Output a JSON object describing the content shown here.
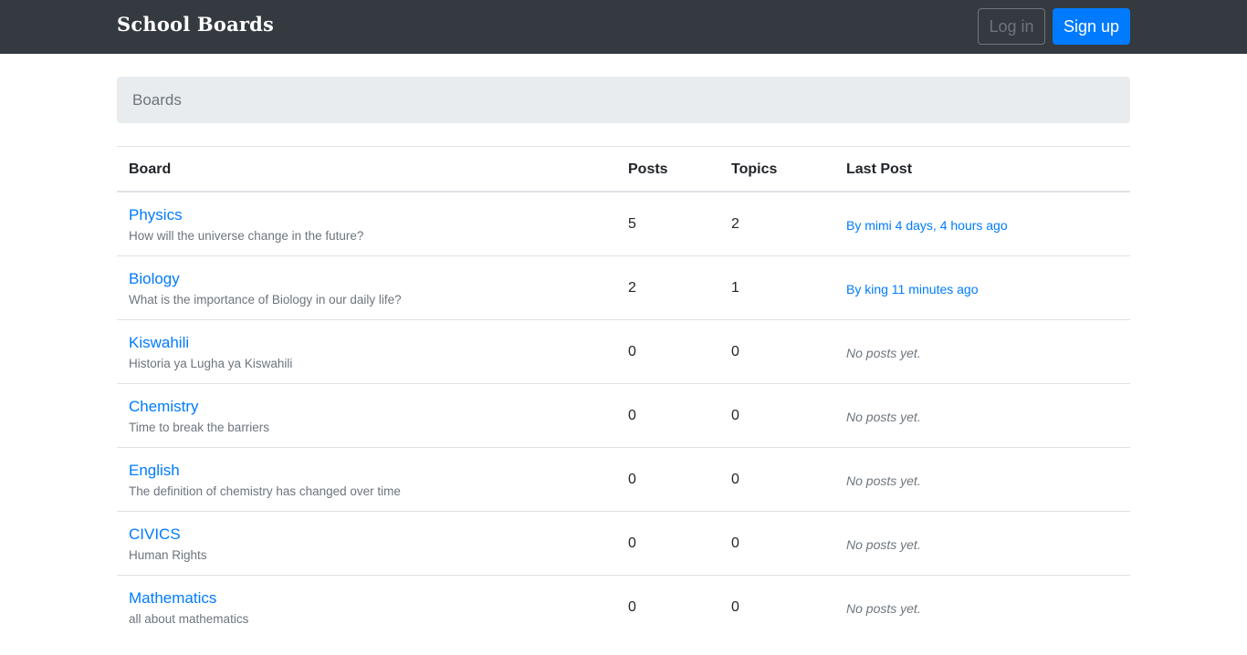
{
  "navbar": {
    "brand": "School Boards",
    "login_label": "Log in",
    "signup_label": "Sign up"
  },
  "breadcrumb": {
    "current": "Boards"
  },
  "table": {
    "headers": {
      "board": "Board",
      "posts": "Posts",
      "topics": "Topics",
      "last_post": "Last Post"
    },
    "rows": [
      {
        "name": "Physics",
        "description": "How will the universe change in the future?",
        "posts": "5",
        "topics": "2",
        "last_post": "By mimi 4 days, 4 hours ago",
        "has_post": true
      },
      {
        "name": "Biology",
        "description": "What is the importance of Biology in our daily life?",
        "posts": "2",
        "topics": "1",
        "last_post": "By king 11 minutes ago",
        "has_post": true
      },
      {
        "name": "Kiswahili",
        "description": "Historia ya Lugha ya Kiswahili",
        "posts": "0",
        "topics": "0",
        "last_post": "No posts yet.",
        "has_post": false
      },
      {
        "name": "Chemistry",
        "description": "Time to break the barriers",
        "posts": "0",
        "topics": "0",
        "last_post": "No posts yet.",
        "has_post": false
      },
      {
        "name": "English",
        "description": "The definition of chemistry has changed over time",
        "posts": "0",
        "topics": "0",
        "last_post": "No posts yet.",
        "has_post": false
      },
      {
        "name": "CIVICS",
        "description": "Human Rights",
        "posts": "0",
        "topics": "0",
        "last_post": "No posts yet.",
        "has_post": false
      },
      {
        "name": "Mathematics",
        "description": "all about mathematics",
        "posts": "0",
        "topics": "0",
        "last_post": "No posts yet.",
        "has_post": false
      }
    ]
  },
  "colors": {
    "navbar_bg": "#343a40",
    "primary": "#007bff",
    "muted": "#6c757d",
    "breadcrumb_bg": "#e9ecef"
  }
}
